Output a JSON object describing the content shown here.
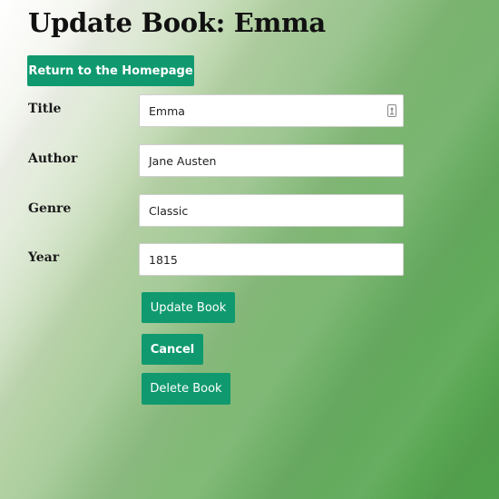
{
  "page": {
    "title": "Update Book: Emma"
  },
  "nav": {
    "home_label": "Return to the Homepage"
  },
  "form": {
    "fields": [
      {
        "label": "Title",
        "value": "Emma"
      },
      {
        "label": "Author",
        "value": "Jane Austen"
      },
      {
        "label": "Genre",
        "value": "Classic"
      },
      {
        "label": "Year",
        "value": "1815"
      }
    ],
    "title_field_icon": "autofill-key-icon"
  },
  "actions": {
    "update_label": "Update Book",
    "cancel_label": "Cancel",
    "delete_label": "Delete Book"
  },
  "colors": {
    "button_bg": "#10996f",
    "button_text": "#ffffff"
  }
}
